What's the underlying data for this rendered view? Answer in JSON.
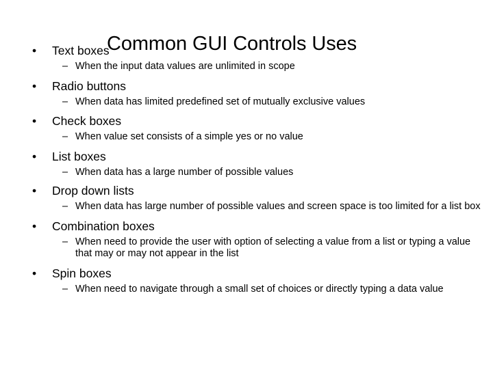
{
  "slide": {
    "title": "Common GUI Controls Uses",
    "bullet_marker": "•",
    "sub_marker": "–",
    "background_color": "#ffffff",
    "text_color": "#000000",
    "items": [
      {
        "label": "Text boxes",
        "detail": "When the input data values are unlimited in scope"
      },
      {
        "label": "Radio buttons",
        "detail": "When data has limited predefined set of mutually exclusive values"
      },
      {
        "label": "Check boxes",
        "detail": "When value set consists of a simple yes or no value"
      },
      {
        "label": "List boxes",
        "detail": "When data has a large number of possible values"
      },
      {
        "label": "Drop down lists",
        "detail": "When data has large number of possible values and screen space is too limited for a list box"
      },
      {
        "label": "Combination boxes",
        "detail": "When need to provide the user with option of selecting a value from a list or typing a value that may or may not appear in the list"
      },
      {
        "label": "Spin boxes",
        "detail": "When need to navigate through a small set of choices or directly typing a data value"
      }
    ]
  }
}
